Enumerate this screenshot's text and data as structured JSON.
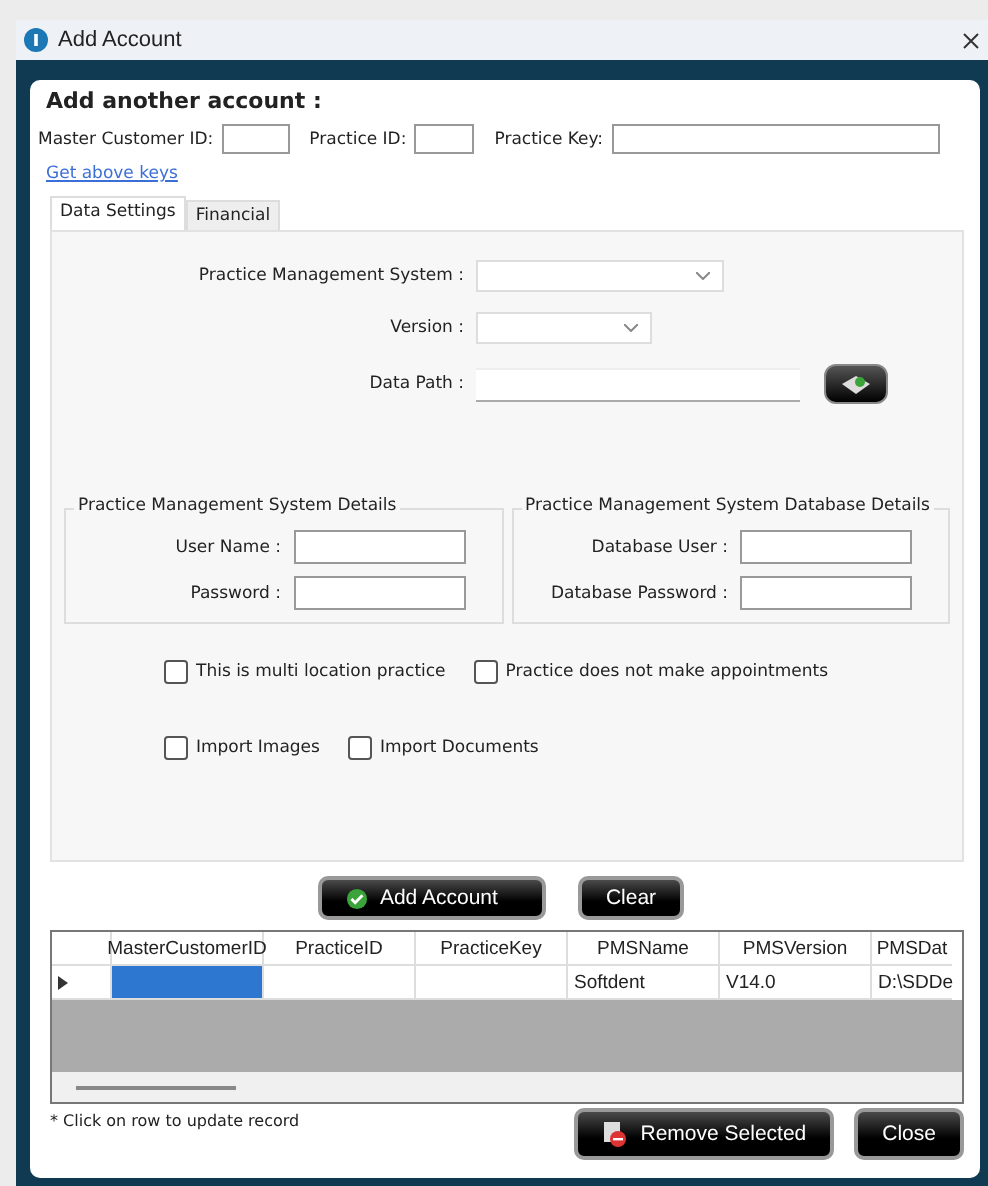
{
  "window": {
    "title": "Add Account"
  },
  "heading": "Add another account :",
  "keys": [
    {
      "label": "Master Customer ID:"
    },
    {
      "label": "Practice ID:"
    },
    {
      "label": "Practice Key:"
    }
  ],
  "link": "Get above keys",
  "tabs": [
    {
      "label": "Data Settings",
      "selected": true
    },
    {
      "label": "Financial",
      "selected": false
    }
  ],
  "settings": [
    {
      "label": "Practice Management System :",
      "kind": "dropdown"
    },
    {
      "label": "Version :",
      "kind": "dropdown"
    },
    {
      "label": "Data Path :",
      "kind": "path"
    }
  ],
  "groups": [
    {
      "title": "Practice Management System Details",
      "fields": [
        {
          "label": "User Name :"
        },
        {
          "label": "Password :"
        }
      ]
    },
    {
      "title": "Practice Management System Database Details",
      "fields": [
        {
          "label": "Database User :"
        },
        {
          "label": "Database Password :"
        }
      ]
    }
  ],
  "options": [
    [
      {
        "label": "This is multi location practice",
        "checked": false
      },
      {
        "label": "Practice does not make appointments",
        "checked": false
      }
    ],
    [
      {
        "label": "Import Images",
        "checked": false
      },
      {
        "label": "Import Documents",
        "checked": false
      }
    ]
  ],
  "actions": [
    {
      "label": "Add Account",
      "kind": "check"
    },
    {
      "label": "Clear",
      "kind": "plain"
    }
  ],
  "grid": {
    "columns": [
      "MasterCustomerID",
      "PracticeID",
      "PracticeKey",
      "PMSName",
      "PMSVersion",
      "PMSDat"
    ],
    "rows": [
      {
        "current": true,
        "cells": [
          {
            "selected": true
          },
          {
            "selected": false
          },
          {
            "selected": false
          },
          {
            "text": "Softdent",
            "selected": false
          },
          {
            "text": "V14.0",
            "selected": false
          },
          {
            "text": "D:\\SDDe",
            "selected": false
          }
        ]
      }
    ]
  },
  "note": "* Click on row to update record",
  "footer_buttons": [
    {
      "label": "Remove Selected",
      "kind": "remove"
    },
    {
      "label": "Close",
      "kind": "plain"
    }
  ]
}
